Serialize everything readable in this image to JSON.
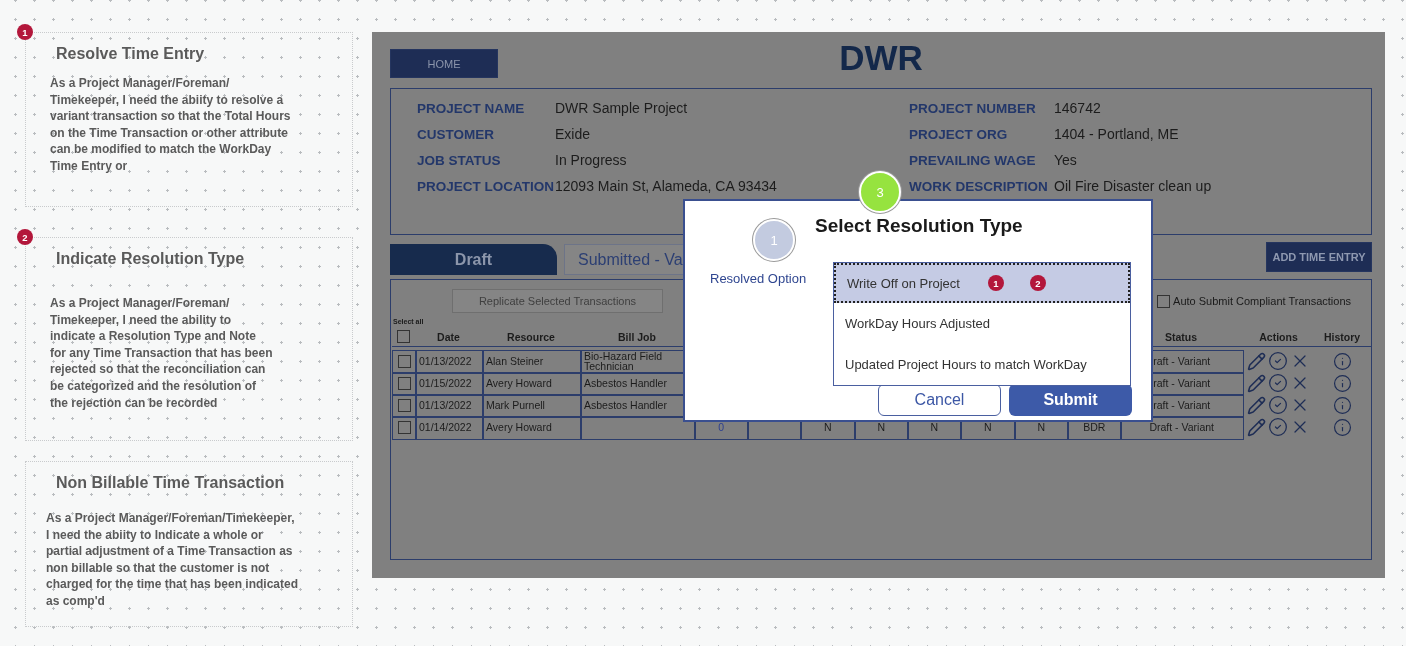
{
  "notes": [
    {
      "marker": "1",
      "title": "Resolve Time Entry",
      "body": "As a Project Manager/Foreman/\nTimekeeper, I need the abiity to resolve a\nvariant transaction so that the Total Hours\non the Time Transaction or other attribute\ncan be modified to match the WorkDay\nTime Entry or"
    },
    {
      "marker": "2",
      "title": "Indicate Resolution Type",
      "body": "As a Project Manager/Foreman/\nTimekeeper, I need the ability to\nindicate a Resolution Type and Note\nfor any Time Transaction that has been\nrejected so that the reconciliation can\nbe categorized and the resolution of\nthe rejection can be recorded"
    },
    {
      "title": "Non Billable Time Transaction",
      "body": "As a Project Manager/Foreman/Timekeeper,\nI need the abiity to Indicate a whole or\npartial adjustment of a Time Transaction as\nnon billable so that the customer is not\ncharged for the time that has been indicated\nas comp'd"
    }
  ],
  "app": {
    "home_button": "HOME",
    "title": "DWR",
    "project_info": {
      "left": [
        {
          "label": "PROJECT NAME",
          "value": "DWR Sample Project"
        },
        {
          "label": "CUSTOMER",
          "value": "Exide"
        },
        {
          "label": "JOB STATUS",
          "value": "In Progress"
        },
        {
          "label": "PROJECT LOCATION",
          "value": "12093 Main St, Alameda, CA 93434"
        }
      ],
      "right": [
        {
          "label": "PROJECT NUMBER",
          "value": "146742"
        },
        {
          "label": "PROJECT ORG",
          "value": "1404 - Portland, ME"
        },
        {
          "label": "PREVAILING WAGE",
          "value": "Yes"
        },
        {
          "label": "WORK DESCRIPTION",
          "value": "Oil Fire Disaster clean up"
        }
      ]
    },
    "tabs": [
      {
        "label": "Draft",
        "selected": true
      },
      {
        "label": "Submitted - Va",
        "selected": false
      }
    ],
    "add_button": "ADD TIME ENTRY",
    "replicate_button": "Replicate Selected Transactions",
    "auto_submit": {
      "label": "Auto Submit Compliant Transactions",
      "checked": false
    },
    "select_all": {
      "label": "Select all",
      "checked": false
    },
    "columns": [
      "Date",
      "Resource",
      "Bill Job",
      "Status",
      "Actions",
      "History"
    ],
    "rows": [
      {
        "checked": false,
        "date": "01/13/2022",
        "resource": "Alan Steiner",
        "bill_job": "Bio-Hazard Field Technician",
        "status": "raft - Variant"
      },
      {
        "checked": false,
        "date": "01/15/2022",
        "resource": "Avery Howard",
        "bill_job": "Asbestos Handler",
        "status": "raft - Variant"
      },
      {
        "checked": false,
        "date": "01/13/2022",
        "resource": "Mark Purnell",
        "bill_job": "Asbestos Handler",
        "status": "raft - Variant"
      },
      {
        "checked": false,
        "date": "01/14/2022",
        "resource": "Avery Howard",
        "column_5": "0",
        "column_7": "N",
        "column_8": "N",
        "column_9": "N",
        "column_10": "N",
        "column_11": "N",
        "column_12": "BDR",
        "status": "Draft - Variant"
      }
    ]
  },
  "modal": {
    "title": "Select Resolution Type",
    "title_marker": "3",
    "option_marker": "1",
    "option_label": "Resolved Option",
    "options": [
      {
        "label": "Write Off on Project",
        "selected": true,
        "markers": [
          "1",
          "2"
        ]
      },
      {
        "label": "WorkDay Hours Adjusted",
        "selected": false
      },
      {
        "label": "Updated Project Hours to match WorkDay",
        "selected": false
      }
    ],
    "cancel": "Cancel",
    "submit": "Submit"
  }
}
